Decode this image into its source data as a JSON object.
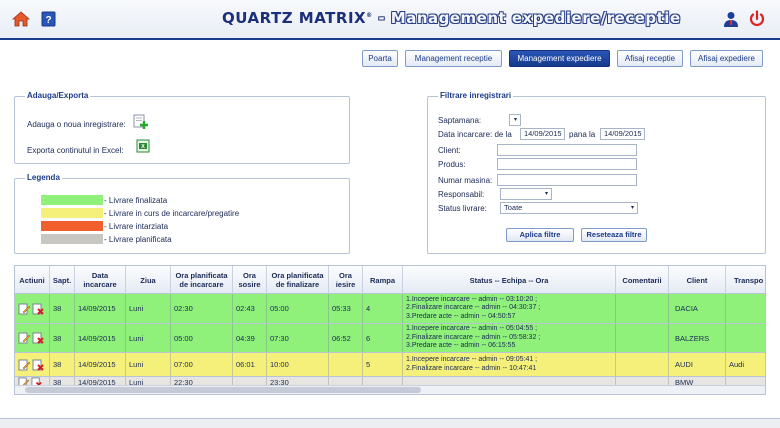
{
  "header": {
    "app_name": "QUARTZ MATRIX",
    "reg_mark": "®",
    "subtitle": " - Management expediere/receptie",
    "icons": [
      "home-icon",
      "help-book-icon",
      "user-icon",
      "power-icon"
    ]
  },
  "nav": {
    "items": [
      {
        "label": "Poarta",
        "active": false
      },
      {
        "label": "Management receptie",
        "active": false
      },
      {
        "label": "Management expediere",
        "active": true
      },
      {
        "label": "Afisaj receptie",
        "active": false
      },
      {
        "label": "Afisaj expediere",
        "active": false
      }
    ]
  },
  "add_export": {
    "title": "Adauga/Exporta",
    "add_label": "Adauga o noua inregistrare:",
    "export_label": "Exporta continutul in Excel:"
  },
  "legend": {
    "title": "Legenda",
    "items": [
      {
        "label": "- Livrare finalizata",
        "color": "#8ff07a"
      },
      {
        "label": "- Livrare in curs de incarcare/pregatire",
        "color": "#f5f07a"
      },
      {
        "label": "- Livrare intarziata",
        "color": "#f0602e"
      },
      {
        "label": "- Livrare planificata",
        "color": "#c8c6c0"
      }
    ]
  },
  "filters": {
    "title": "Filtrare inregistrari",
    "week_label": "Saptamana:",
    "week_value": "",
    "date_label": "Data incarcare: de la",
    "date_from": "14/09/2015",
    "date_to_label": "pana la",
    "date_to": "14/09/2015",
    "client_label": "Client:",
    "client_value": "",
    "product_label": "Produs:",
    "product_value": "",
    "plate_label": "Numar masina:",
    "plate_value": "",
    "responsible_label": "Responsabil:",
    "responsible_value": "",
    "status_label": "Status livrare:",
    "status_value": "Toate",
    "apply_label": "Aplica filtre",
    "reset_label": "Reseteaza filtre"
  },
  "table": {
    "columns": [
      "Actiuni",
      "Sapt.",
      "Data incarcare",
      "Ziua",
      "Ora planificata de incarcare",
      "Ora sosire",
      "Ora planificata de finalizare",
      "Ora iesire",
      "Rampa",
      "Status -- Echipa -- Ora",
      "Comentarii",
      "Client",
      "Transpo"
    ],
    "rows": [
      {
        "color": "#8ff07a",
        "week": "38",
        "date": "14/09/2015",
        "day": "Luni",
        "plan_load": "02:30",
        "arrival": "02:43",
        "plan_finish": "05:00",
        "exit": "05:33",
        "ramp": "4",
        "status": [
          "1.Incepere incarcare -- admin -- 03:10:20 ;",
          "2.Finalizare incarcare -- admin -- 04:30:37 ;",
          "3.Predare acte -- admin -- 04:50:57"
        ],
        "comments": "",
        "client": "DACIA",
        "transport": ""
      },
      {
        "color": "#8ff07a",
        "week": "38",
        "date": "14/09/2015",
        "day": "Luni",
        "plan_load": "05:00",
        "arrival": "04:39",
        "plan_finish": "07:30",
        "exit": "06:52",
        "ramp": "6",
        "status": [
          "1.Incepere incarcare -- admin -- 05:04:55 ;",
          "2.Finalizare incarcare -- admin -- 05:58:32 ;",
          "3.Predare acte -- admin -- 06:15:55"
        ],
        "comments": "",
        "client": "BALZERS",
        "transport": ""
      },
      {
        "color": "#f5f07a",
        "week": "38",
        "date": "14/09/2015",
        "day": "Luni",
        "plan_load": "07:00",
        "arrival": "06:01",
        "plan_finish": "10:00",
        "exit": "",
        "ramp": "5",
        "status": [
          "1.Incepere incarcare -- admin -- 09:05:41 ;",
          "2.Finalizare incarcare -- admin -- 10:47:41"
        ],
        "comments": "",
        "client": "AUDI",
        "transport": "Audi"
      },
      {
        "color": "#e6e5e1",
        "week": "38",
        "date": "14/09/2015",
        "day": "Luni",
        "plan_load": "22:30",
        "arrival": "",
        "plan_finish": "23:30",
        "exit": "",
        "ramp": "",
        "status": [],
        "comments": "",
        "client": "BMW",
        "transport": ""
      }
    ]
  }
}
